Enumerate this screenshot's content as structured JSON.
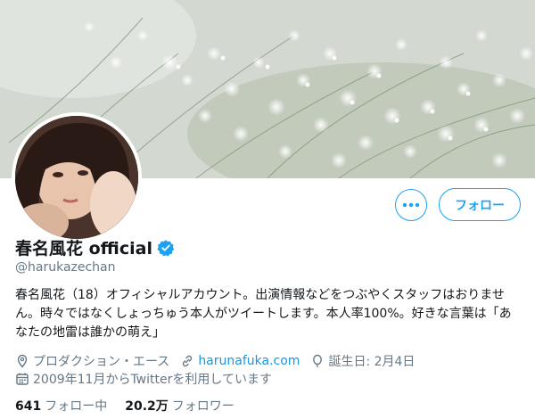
{
  "profile": {
    "display_name": "春名風花 official",
    "handle": "@harukazechan",
    "bio": "春名風花（18）オフィシャルアカウント。出演情報などをつぶやくスタッフはおりません。時々ではなくしょっちゅう本人がツイートします。本人率100%。好きな言葉は「あなたの地雷は誰かの萌え」",
    "verified": true
  },
  "buttons": {
    "follow_label": "フォロー",
    "more_icon": "more-dots-icon"
  },
  "meta": {
    "location": "プロダクション・エース",
    "website": "harunafuka.com",
    "birthday": "誕生日: 2月4日",
    "joined": "2009年11月からTwitterを利用しています"
  },
  "stats": {
    "following_count": "641",
    "following_label": "フォロー中",
    "followers_count": "20.2万",
    "followers_label": "フォロワー"
  },
  "colors": {
    "accent": "#1da1f2",
    "link": "#1b95e0",
    "secondary_text": "#657786",
    "primary_text": "#14171a"
  }
}
